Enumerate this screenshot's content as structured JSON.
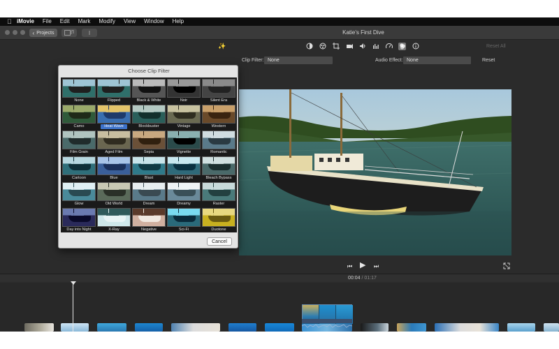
{
  "menubar": {
    "apple": "",
    "items": [
      "iMovie",
      "File",
      "Edit",
      "Mark",
      "Modify",
      "View",
      "Window",
      "Help"
    ]
  },
  "toolbar": {
    "projects_label": "Projects",
    "window_title": "Katie's First Dive"
  },
  "adjustments": {
    "icons": [
      "color-balance-icon",
      "color-correction-icon",
      "crop-icon",
      "stabilization-icon",
      "volume-icon",
      "noise-reduction-icon",
      "speed-icon",
      "clip-filter-icon",
      "info-icon"
    ],
    "active_icon": "clip-filter-icon",
    "reset_all_label": "Reset All"
  },
  "effects": {
    "clip_filter_label": "Clip Filter:",
    "clip_filter_value": "None",
    "audio_effect_label": "Audio Effect:",
    "audio_effect_value": "None",
    "reset_label": "Reset"
  },
  "dialog": {
    "title": "Choose Clip Filter",
    "cancel_label": "Cancel",
    "selected": "Heat Wave",
    "filters": [
      "None",
      "Flipped",
      "Black & White",
      "Noir",
      "Silent Era",
      "Camo",
      "Heat Wave",
      "Blockbuster",
      "Vintage",
      "Western",
      "Film Grain",
      "Aged Film",
      "Sepia",
      "Vignette",
      "Romantic",
      "Cartoon",
      "Blue",
      "Blast",
      "Hard Light",
      "Bleach Bypass",
      "Glow",
      "Old World",
      "Dream",
      "Dreamy",
      "Raster",
      "Day into Night",
      "X-Ray",
      "Negative",
      "Sci-Fi",
      "Duotone"
    ]
  },
  "timeline": {
    "current_time": "00:04",
    "separator": "/",
    "total_time": "01:17"
  },
  "colors": {
    "accent": "#3d72c9",
    "background": "#2b2b2b",
    "dialog_bg": "#e4e4e4"
  }
}
